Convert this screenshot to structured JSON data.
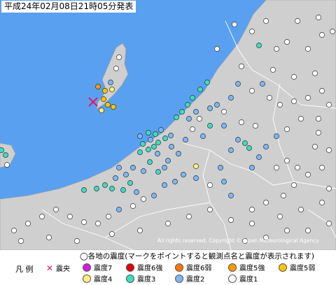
{
  "header": {
    "timestamp": "平成24年02月08日21時05分発表"
  },
  "copyright": "All rights reserved. Copyright © Japan Meteorological Agency",
  "legend": {
    "title": "◯各地の震度(マークをポイントすると観測点名と震度が表示されます)",
    "label": "凡 例",
    "epicenter": "震央",
    "intensity_items": [
      {
        "label": "震度7",
        "color": "#d21ce0"
      },
      {
        "label": "震度6強",
        "color": "#e00000"
      },
      {
        "label": "震度6弱",
        "color": "#ff7700"
      },
      {
        "label": "震度5強",
        "color": "#ff9900"
      },
      {
        "label": "震度5弱",
        "color": "#f7c600"
      },
      {
        "label": "震度4",
        "color": "#fff07a"
      },
      {
        "label": "震度3",
        "color": "#3ddcc0"
      },
      {
        "label": "震度2",
        "color": "#7ab8f5"
      },
      {
        "label": "震度1",
        "color": "#ffffff"
      }
    ]
  },
  "colors": {
    "sea": "#5aa0f0",
    "land": "#cfcfcf",
    "border": "#ffffff",
    "epicenter": "#e0186a"
  }
}
